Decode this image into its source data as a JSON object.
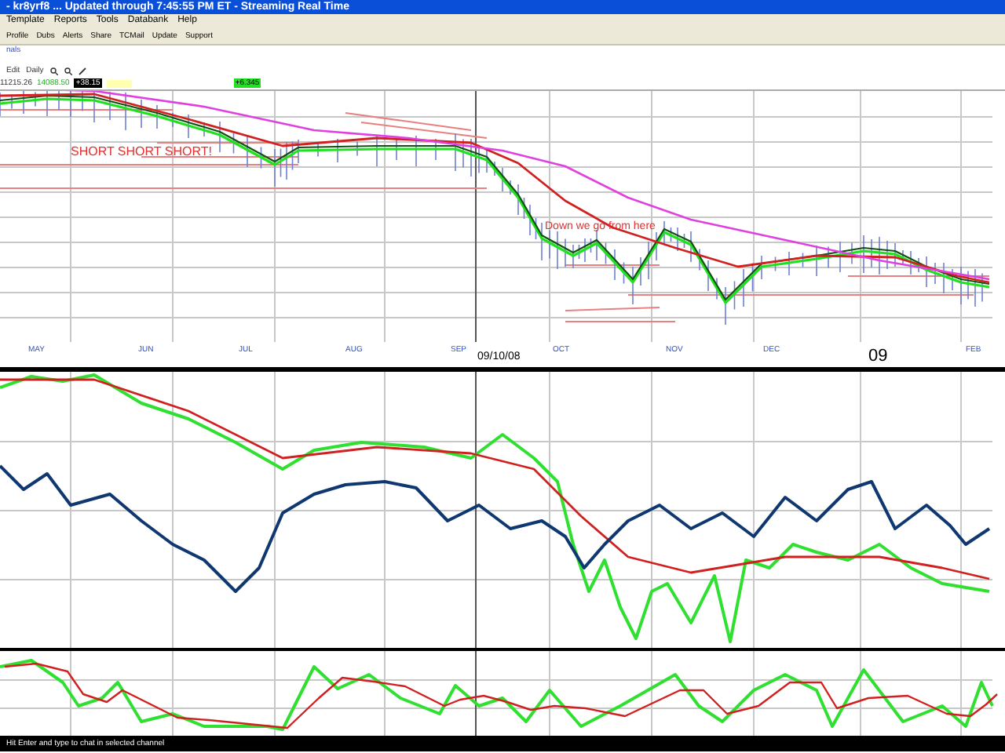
{
  "window": {
    "title": "- kr8yrf8 ... Updated through 7:45:55 PM ET - Streaming Real Time"
  },
  "menu": [
    "Template",
    "Reports",
    "Tools",
    "Databank",
    "Help"
  ],
  "toolbar": [
    "Profile",
    "Dubs",
    "Alerts",
    "Share",
    "TCMail",
    "Update",
    "Support"
  ],
  "panel_label": "nals",
  "chart_toolbar": {
    "edit": "Edit",
    "period": "Daily"
  },
  "quote": {
    "value_1": "11215.26",
    "value_2": "14088.50",
    "change": "+38.15",
    "badge": "+6.345"
  },
  "months": [
    "MAY",
    "JUN",
    "JUL",
    "AUG",
    "SEP",
    "OCT",
    "NOV",
    "DEC",
    "FEB"
  ],
  "cursor_date": "09/10/08",
  "year_label": "09",
  "annotations": [
    "SHORT SHORT SHORT!",
    "Down we go from here"
  ],
  "status_bar": "Hit Enter and type to chat in selected channel"
}
